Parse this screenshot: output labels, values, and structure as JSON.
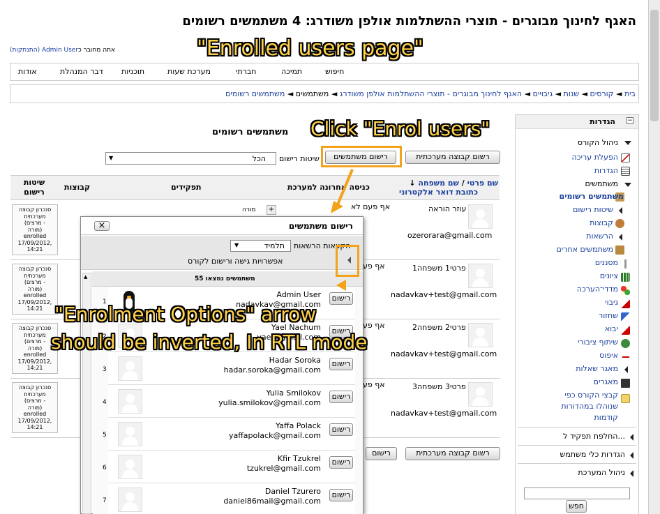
{
  "page": {
    "title": "האגף לחינוך מבוגרים - תוצרי ההשתלמות אולפן משודרג: 4 משתמשים רשומים",
    "login_prefix": "אתה מחובר כ",
    "login_user": "Admin User",
    "logout": "(התנתקות)"
  },
  "navbar": [
    "אודות",
    "דבר המנהלת",
    "תוכניות",
    "מערכת שעות",
    "חברתי",
    "תמיכה",
    "חיפוש"
  ],
  "breadcrumb": [
    {
      "label": "בית",
      "link": true
    },
    {
      "label": "קורסים",
      "link": true
    },
    {
      "label": "שנות",
      "link": true
    },
    {
      "label": "גיבויים",
      "link": true
    },
    {
      "label": "האגף לחינוך מבוגרים - תוצרי ההשתלמות אולפן משודרג",
      "link": true
    },
    {
      "label": "משתמשים",
      "link": false
    },
    {
      "label": "משתמשים רשומים",
      "link": true
    }
  ],
  "breadcrumb_sep": "◄",
  "settings": {
    "title": "הגדרות",
    "collapse": "−",
    "course_admin": "ניהול הקורס",
    "edit_on": "הפעלת עריכה",
    "settings_item": "הגדרות",
    "users": "משתמשים",
    "enrolled_users": "משתמשים רשומים",
    "enrol_methods": "שיטות רישום",
    "groups": "קבוצות",
    "permissions": "הרשאות",
    "other_users": "משתמשים אחרים",
    "filters": "מסננים",
    "grades": "ציונים",
    "outcomes": "מדדי־הערכה",
    "backup": "גיבוי",
    "restore": "שחזור",
    "import": "יבוא",
    "publish": "שיתוף ציבורי",
    "reset": "איפוס",
    "question_bank": "מאגר שאלות",
    "repositories": "מאגרים",
    "legacy_files_1": "קבצי הקורס כפי",
    "legacy_files_2": "שנוהלו במהדורות",
    "legacy_files_3": "קודמות",
    "switch_role": "החלפת תפקיד ל...",
    "profile_settings": "הגדרות כלי משתמש",
    "site_admin": "ניהול המערכת",
    "search_button": "חפש"
  },
  "main": {
    "heading": "משתמשים רשומים",
    "enrol_users_button": "רישום משתמשים",
    "enrol_cohort_button": "רשום קבוצה מערכתית",
    "enrol_method_label": "שיטות רישום",
    "enrol_method_value": "הכל",
    "columns": {
      "name_first": "שם פרטי",
      "name_sep": " / ",
      "name_last": "שם משפחה",
      "email": "כתובת דואר אלקטרוני",
      "last_access": "כניסה אחרונה למערכת",
      "roles": "תפקידים",
      "groups": "קבוצות",
      "enrolment": "שיטות רישום"
    },
    "rows": [
      {
        "name": "עוזר הוראה",
        "email": "ozerorara@gmail.com",
        "access": "אף פעם לא",
        "role": "מורה",
        "note": [
          "סנכרון קבוצה",
          "מערכתית",
          "(מרצים -",
          "מורה)",
          "enrolled",
          "17/09/2012,",
          "14:21"
        ]
      },
      {
        "name": "פרטי1 משפחה1",
        "email": "nadavkav+test@gmail.com",
        "access": "אף פע",
        "role": "",
        "note": [
          "סנכרון קבוצה",
          "מערכתית",
          "(מרצים -",
          "מורה)",
          "enrolled",
          "17/09/2012,",
          "14:21"
        ]
      },
      {
        "name": "פרטי2 משפחה2",
        "email": "nadavkav+test@gmail.com",
        "access": "אף פע",
        "role": "",
        "note": [
          "סנכרון קבוצה",
          "מערכתית",
          "(מרצים -",
          "מורה)",
          "enrolled",
          "17/09/2012,",
          "14:21"
        ]
      },
      {
        "name": "פרטי3 משפחה3",
        "email": "nadavkav+test@gmail.com",
        "access": "אף פע",
        "role": "",
        "note": [
          "סנכרון קבוצה",
          "מערכתית",
          "(מרצים -",
          "מורה)",
          "enrolled",
          "17/09/2012,",
          "14:21"
        ]
      }
    ],
    "bottom_enrol_button": "רישום",
    "bottom_cohort_button": "רשום קבוצה מערכתית"
  },
  "dialog": {
    "title": "רישום משתמשים",
    "close": "×",
    "role_label": "הקצאות הרשאות",
    "role_value": "תלמיד",
    "options_label": "אפשרויות גישה ורישום לקורס",
    "found": "55 משתמשים נמצאו",
    "enrol_button": "רישום",
    "users": [
      {
        "num": "1",
        "name": "Admin User",
        "email": "nadavkav@gmail.com"
      },
      {
        "num": "2",
        "name": "Yael Nachum",
        "email": "yael@gmail.com"
      },
      {
        "num": "3",
        "name": "Hadar Soroka",
        "email": "hadar.soroka@gmail.com"
      },
      {
        "num": "4",
        "name": "Yulia Smilokov",
        "email": "yulia.smilokov@gmail.com"
      },
      {
        "num": "5",
        "name": "Yaffa Polack",
        "email": "yaffapolack@gmail.com"
      },
      {
        "num": "6",
        "name": "Kfir Tzukrel",
        "email": "tzukrel@gmail.com"
      },
      {
        "num": "7",
        "name": "Daniel Tzurero",
        "email": "daniel86mail@gmail.com"
      }
    ]
  },
  "annotations": {
    "enrolled_page": "\"Enrolled users page\"",
    "click_enrol": "Click \"Enrol users\"",
    "rtl_note_1": "\"Enrolment Options\" arrow",
    "rtl_note_2": "should be inverted, In RTL mode"
  },
  "colors": {
    "annotation_text": "#ffd24a",
    "annotation_box": "#f2a21b",
    "link": "#1a3f9c"
  }
}
